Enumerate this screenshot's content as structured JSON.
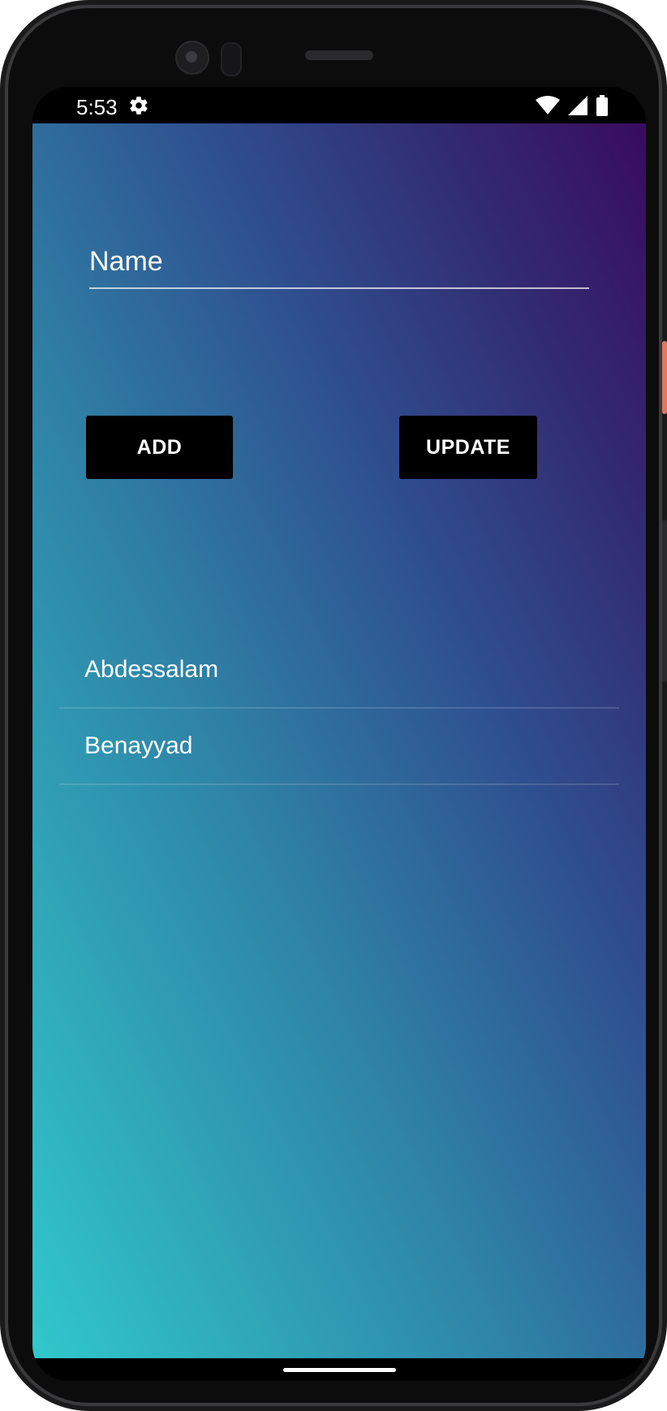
{
  "status_bar": {
    "time": "5:53",
    "icons": [
      "gear-icon",
      "wifi-icon",
      "cellular-signal-icon",
      "battery-icon"
    ]
  },
  "form": {
    "name_placeholder": "Name",
    "name_value": ""
  },
  "buttons": {
    "add_label": "ADD",
    "update_label": "UPDATE"
  },
  "list": {
    "items": [
      {
        "label": "Abdessalam"
      },
      {
        "label": "Benayyad"
      }
    ]
  },
  "colors": {
    "gradient_top_right": "#390b60",
    "gradient_bottom_left": "#30c8cb",
    "button_background": "#000000",
    "text": "#ffffff"
  }
}
